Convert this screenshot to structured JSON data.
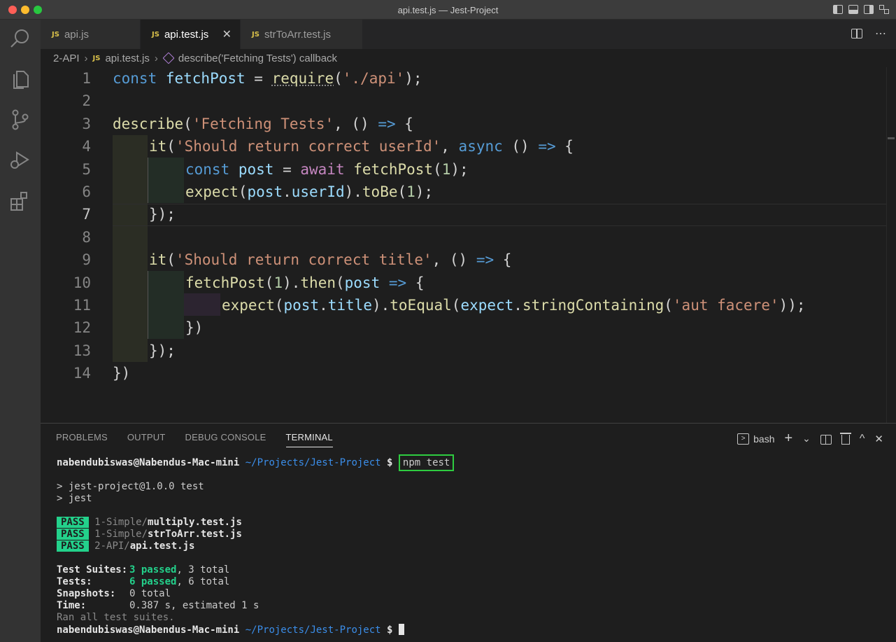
{
  "window": {
    "title": "api.test.js — Jest-Project"
  },
  "activity_bar": {
    "icons": [
      "explorer-search-icon",
      "files-icon",
      "source-control-icon",
      "run-debug-icon",
      "extensions-icon"
    ]
  },
  "tabs": [
    {
      "label": "api.js",
      "badge": "JS",
      "active": false
    },
    {
      "label": "api.test.js",
      "badge": "JS",
      "active": true,
      "close": "✕"
    },
    {
      "label": "strToArr.test.js",
      "badge": "JS",
      "active": false
    }
  ],
  "breadcrumb": {
    "folder": "2-API",
    "file_badge": "JS",
    "file": "api.test.js",
    "symbol": "describe('Fetching Tests') callback"
  },
  "editor": {
    "current_line": 7,
    "line_numbers": [
      "1",
      "2",
      "3",
      "4",
      "5",
      "6",
      "7",
      "8",
      "9",
      "10",
      "11",
      "12",
      "13",
      "14"
    ],
    "lines": {
      "l1": {
        "kw": "const",
        "name": " fetchPost",
        "op": " = ",
        "fn": "require",
        "open": "(",
        "str": "'./api'",
        "close": ");"
      },
      "l3": {
        "fn": "describe",
        "open": "(",
        "str": "'Fetching Tests'",
        "mid": ", () ",
        "arrow": "=>",
        "close": " {"
      },
      "l4": {
        "fn": "it",
        "open": "(",
        "str": "'Should return correct userId'",
        "comma": ", ",
        "kw": "async",
        "mid": " () ",
        "arrow": "=>",
        "close": " {"
      },
      "l5": {
        "kw": "const",
        "name": " post",
        "op": " = ",
        "await": "await",
        "sp": " ",
        "fn": "fetchPost",
        "open": "(",
        "num": "1",
        "close": ");"
      },
      "l6": {
        "fn": "expect",
        "open": "(",
        "obj": "post",
        "dot": ".",
        "prop": "userId",
        "close1": ").",
        "fn2": "toBe",
        "open2": "(",
        "num": "1",
        "close2": ");"
      },
      "l7": {
        "text": "});"
      },
      "l9": {
        "fn": "it",
        "open": "(",
        "str": "'Should return correct title'",
        "mid": ", () ",
        "arrow": "=>",
        "close": " {"
      },
      "l10": {
        "fn": "fetchPost",
        "open": "(",
        "num": "1",
        "close1": ").",
        "fn2": "then",
        "open2": "(",
        "param": "post",
        "sp": " ",
        "arrow": "=>",
        "close": " {"
      },
      "l11": {
        "fn": "expect",
        "open": "(",
        "obj": "post",
        "dot": ".",
        "prop": "title",
        "close1": ").",
        "fn2": "toEqual",
        "open2": "(",
        "obj2": "expect",
        "dot2": ".",
        "fn3": "stringContaining",
        "open3": "(",
        "str": "'aut facere'",
        "close": "));"
      },
      "l12": {
        "text": "})"
      },
      "l13": {
        "text": "});"
      },
      "l14": {
        "text": "})"
      }
    }
  },
  "panel": {
    "tabs": [
      "PROBLEMS",
      "OUTPUT",
      "DEBUG CONSOLE",
      "TERMINAL"
    ],
    "active_tab": "TERMINAL",
    "shell": "bash",
    "actions": {
      "add": "+",
      "dropdown": "⌄",
      "maximize": "^",
      "close": "✕"
    }
  },
  "terminal": {
    "prompt_user": "nabendubiswas@Nabendus-Mac-mini",
    "prompt_path": "~/Projects/Jest-Project",
    "prompt_sign": "$",
    "command": "npm test",
    "script_line1": "> jest-project@1.0.0 test",
    "script_line2": "> jest",
    "results": [
      {
        "badge": "PASS",
        "dir": "1-Simple/",
        "file": "multiply.test.js"
      },
      {
        "badge": "PASS",
        "dir": "1-Simple/",
        "file": "strToArr.test.js"
      },
      {
        "badge": "PASS",
        "dir": "2-API/",
        "file": "api.test.js"
      }
    ],
    "summary": {
      "suites_label": "Test Suites:",
      "suites_passed": "3 passed",
      "suites_total": ", 3 total",
      "tests_label": "Tests:",
      "tests_passed": "6 passed",
      "tests_total": ", 6 total",
      "snapshots_label": "Snapshots:",
      "snapshots_value": "0 total",
      "time_label": "Time:",
      "time_value": "0.387 s, estimated 1 s",
      "ran_all": "Ran all test suites."
    }
  }
}
